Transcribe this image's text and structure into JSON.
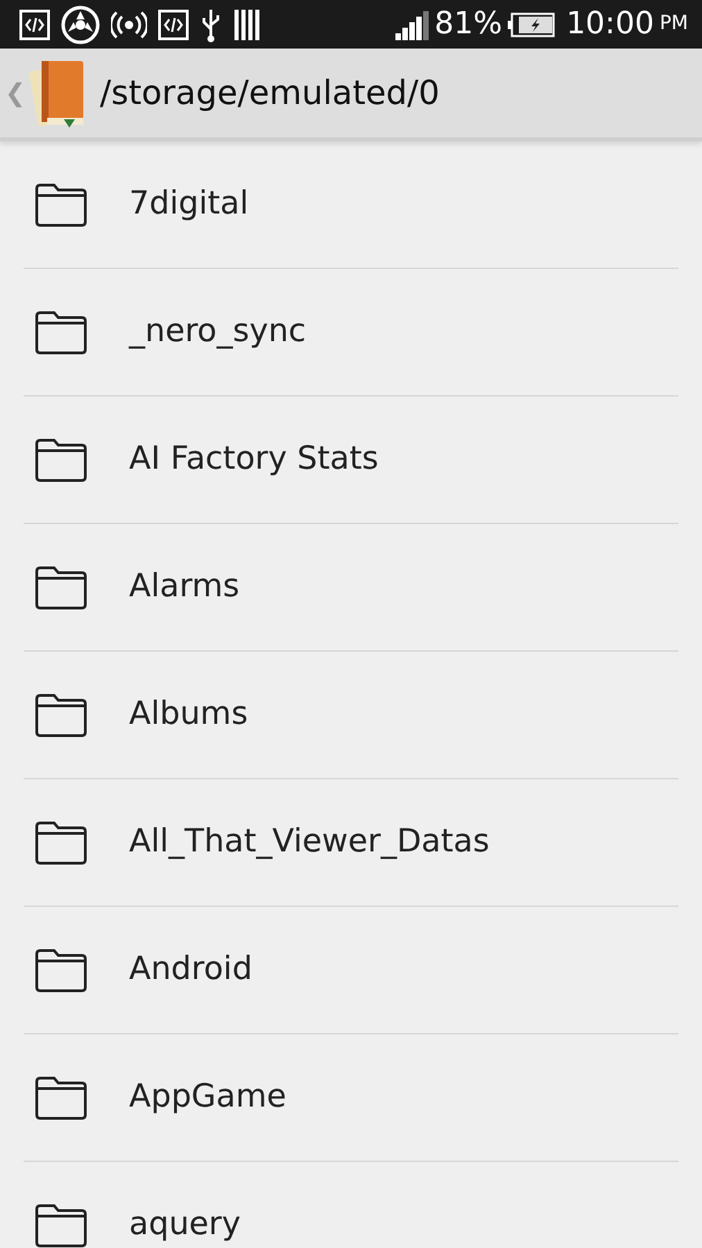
{
  "status_bar": {
    "battery_percent": "81%",
    "time": "10:00",
    "meridiem": "PM"
  },
  "header": {
    "back": "❮",
    "path": "/storage/emulated/0"
  },
  "folders": [
    {
      "name": "7digital"
    },
    {
      "name": "_nero_sync"
    },
    {
      "name": "AI Factory Stats"
    },
    {
      "name": "Alarms"
    },
    {
      "name": "Albums"
    },
    {
      "name": "All_That_Viewer_Datas"
    },
    {
      "name": "Android"
    },
    {
      "name": "AppGame"
    },
    {
      "name": "aquery"
    }
  ]
}
